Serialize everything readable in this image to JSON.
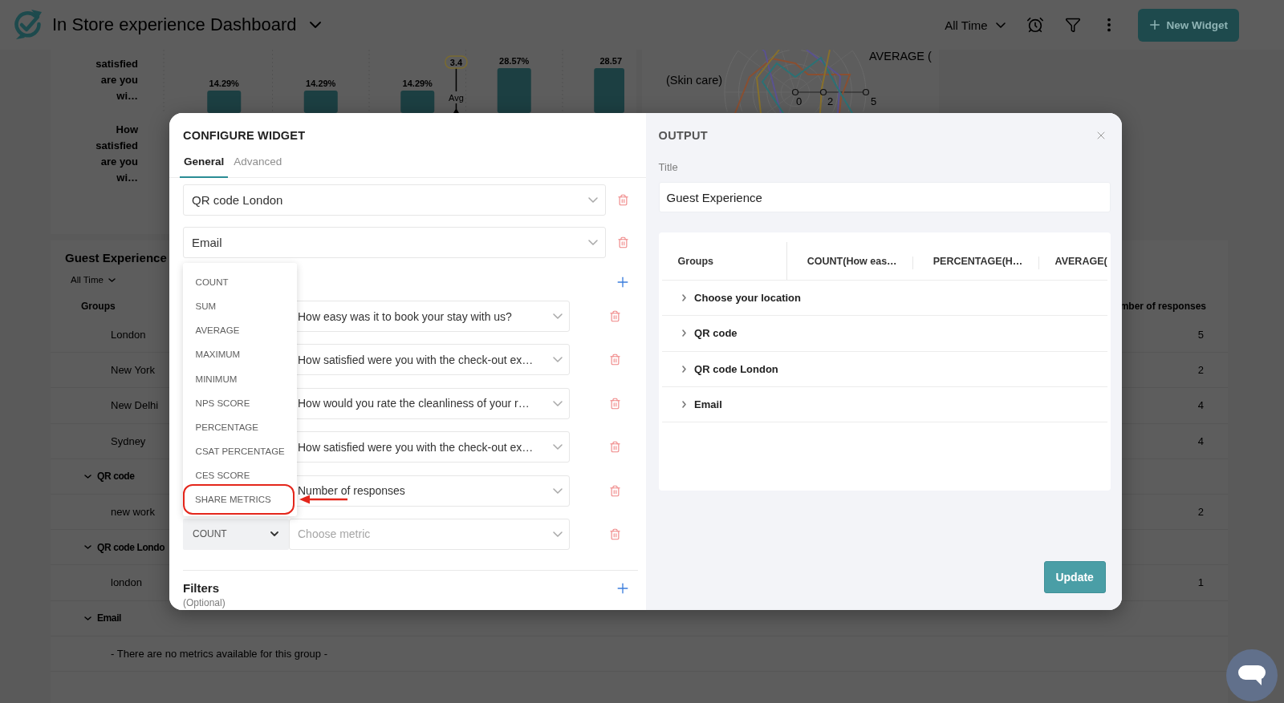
{
  "header": {
    "title": "In Store experience Dashboard",
    "time_filter": "All Time",
    "new_widget_button": "New Widget"
  },
  "chart_card": {
    "question_labels": [
      "satisfied are you wi…",
      "How satisfied are you wi…"
    ],
    "bar_labels": [
      "14.29%",
      "14.29%",
      "14.29%",
      "28.57%",
      "28.57"
    ],
    "average_marker": {
      "value": "3.4",
      "caption": "Avg"
    }
  },
  "radar_card": {
    "axis_labels": [
      "(Skin care)",
      "AVERAGE ("
    ],
    "ticks": [
      "0",
      "2",
      "5"
    ]
  },
  "guest_card": {
    "title": "Guest Experience",
    "time_filter": "All Time",
    "columns": [
      "Groups",
      "mber of responses"
    ],
    "groups": [
      {
        "children": [
          {
            "name": "London",
            "value": "5"
          },
          {
            "name": "New York",
            "value": "2"
          },
          {
            "name": "New Delhi",
            "value": "4"
          },
          {
            "name": "Sydney",
            "value": "4"
          }
        ]
      },
      {
        "name": "QR code",
        "expanded": true,
        "children": [
          {
            "name": "new work",
            "value": "2"
          }
        ]
      },
      {
        "name": "QR code Londo",
        "expanded": true,
        "children": [
          {
            "name": "london",
            "value": "1"
          }
        ]
      },
      {
        "name": "Email",
        "expanded": true,
        "note": "- There are no metrics available for this group -"
      }
    ]
  },
  "dialog": {
    "config": {
      "title": "CONFIGURE WIDGET",
      "tabs": [
        {
          "label": "General",
          "selected": true
        },
        {
          "label": "Advanced",
          "selected": false
        }
      ],
      "group_fields": [
        {
          "value": "QR code London"
        },
        {
          "value": "Email"
        }
      ],
      "metrics": [
        {
          "value": "How easy was it to book your stay with us?"
        },
        {
          "value": "How satisfied were you with the check-out ex…"
        },
        {
          "value": "How would you rate the cleanliness of your r…"
        },
        {
          "value": "How satisfied were you with the check-out ex…"
        },
        {
          "value": "Number of responses"
        },
        {
          "aggregate": "COUNT",
          "placeholder": "Choose metric",
          "menu": {
            "options": [
              {
                "label": "COUNT",
                "highlighted": false
              },
              {
                "label": "SUM",
                "highlighted": false
              },
              {
                "label": "AVERAGE",
                "highlighted": false
              },
              {
                "label": "MAXIMUM",
                "highlighted": false
              },
              {
                "label": "MINIMUM",
                "highlighted": false
              },
              {
                "label": "NPS SCORE",
                "highlighted": false
              },
              {
                "label": "PERCENTAGE",
                "highlighted": false
              },
              {
                "label": "CSAT PERCENTAGE",
                "highlighted": false
              },
              {
                "label": "CES SCORE",
                "highlighted": false
              },
              {
                "label": "SHARE METRICS",
                "highlighted": true
              }
            ]
          }
        }
      ],
      "filters": {
        "title": "Filters",
        "hint": "(Optional)"
      }
    },
    "output": {
      "title": "OUTPUT",
      "title_field": {
        "label": "Title",
        "value": "Guest Experience"
      },
      "table": {
        "columns": [
          "Groups",
          "COUNT(How eas…",
          "PERCENTAGE(H…",
          "AVERAGE("
        ],
        "rows": [
          {
            "label": "Choose your location",
            "expanded": false
          },
          {
            "label": "QR code",
            "expanded": false
          },
          {
            "label": "QR code London",
            "expanded": false
          },
          {
            "label": "Email",
            "expanded": false
          }
        ]
      },
      "update_button": "Update"
    }
  }
}
